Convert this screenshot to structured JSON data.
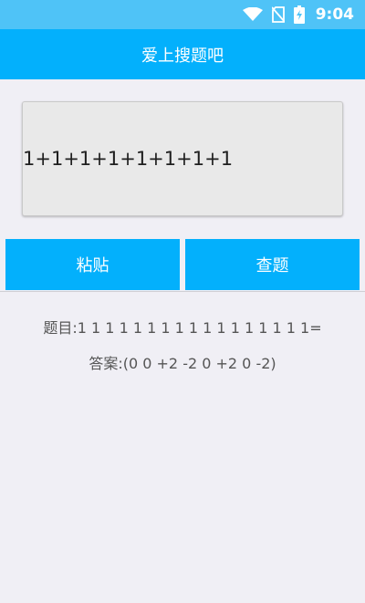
{
  "status_bar": {
    "time": "9:04",
    "icons": [
      "wifi-icon",
      "no-sim-icon",
      "battery-charging-icon"
    ],
    "color": "#4fc3f7"
  },
  "app_bar": {
    "title": "爱上搜题吧",
    "color": "#03b0fc"
  },
  "input": {
    "value": "1+1+1+1+1+1+1+1"
  },
  "buttons": {
    "paste_label": "粘贴",
    "search_label": "查题",
    "color": "#03b0fc"
  },
  "result": {
    "question": "题目:1 1 1 1 1 1 1 1 1 1 1 1 1 1 1 1 1=",
    "answer": "答案:(0 0 +2 -2 0 +2 0 -2)"
  }
}
